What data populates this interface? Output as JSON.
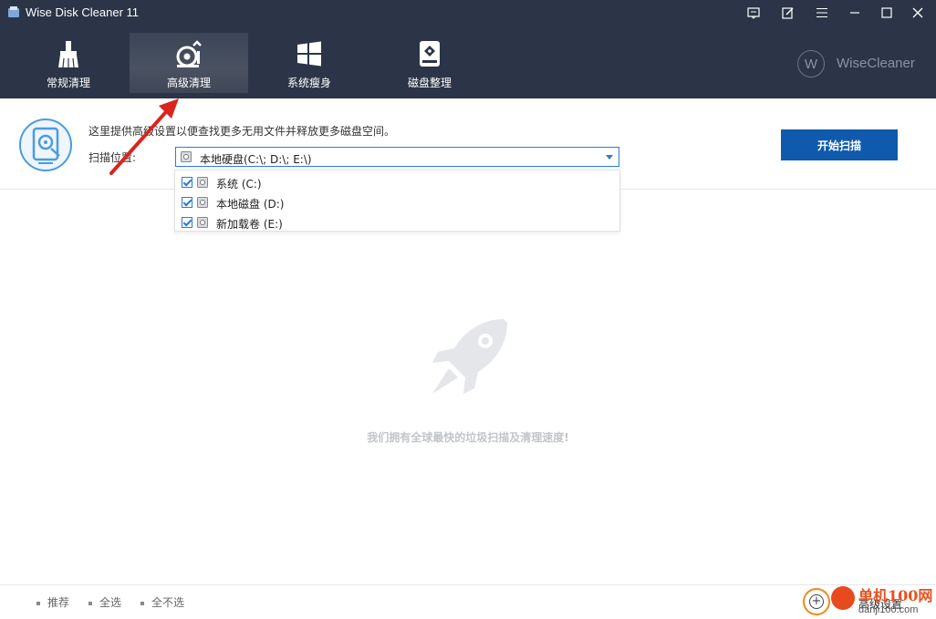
{
  "window": {
    "title": "Wise Disk Cleaner 11",
    "controls": [
      "feedback-icon",
      "edit-icon",
      "menu-icon",
      "minimize-icon",
      "maximize-icon",
      "close-icon"
    ]
  },
  "nav": {
    "tabs": [
      {
        "label": "常规清理",
        "icon": "broom-icon",
        "active": false
      },
      {
        "label": "高级清理",
        "icon": "vacuum-icon",
        "active": true
      },
      {
        "label": "系统瘦身",
        "icon": "windows-icon",
        "active": false
      },
      {
        "label": "磁盘整理",
        "icon": "hard-drive-icon",
        "active": false
      }
    ],
    "brand": {
      "mark": "W",
      "text": "WiseCleaner"
    }
  },
  "info": {
    "description": "这里提供高级设置以便查找更多无用文件并释放更多磁盘空间。",
    "scan_label": "扫描位置:",
    "scan_value": "本地硬盘(C:\\; D:\\; E:\\)",
    "start_button": "开始扫描"
  },
  "dropdown": {
    "items": [
      {
        "label": "系统 (C:)",
        "checked": true
      },
      {
        "label": "本地磁盘 (D:)",
        "checked": true
      },
      {
        "label": "新加载卷 (E:)",
        "checked": true
      }
    ]
  },
  "empty_state": {
    "icon": "rocket-icon",
    "text": "我们拥有全球最快的垃圾扫描及清理速度!"
  },
  "footer": {
    "links": [
      "推荐",
      "全选",
      "全不选"
    ],
    "advanced": "高级设置",
    "watermark": {
      "line1": "单机100网",
      "line2": "danji100.com"
    }
  },
  "colors": {
    "header_bg": "#2b3547",
    "accent_blue": "#0f5aad",
    "border_blue": "#2b7bd6",
    "annotation_red": "#d9251d"
  }
}
